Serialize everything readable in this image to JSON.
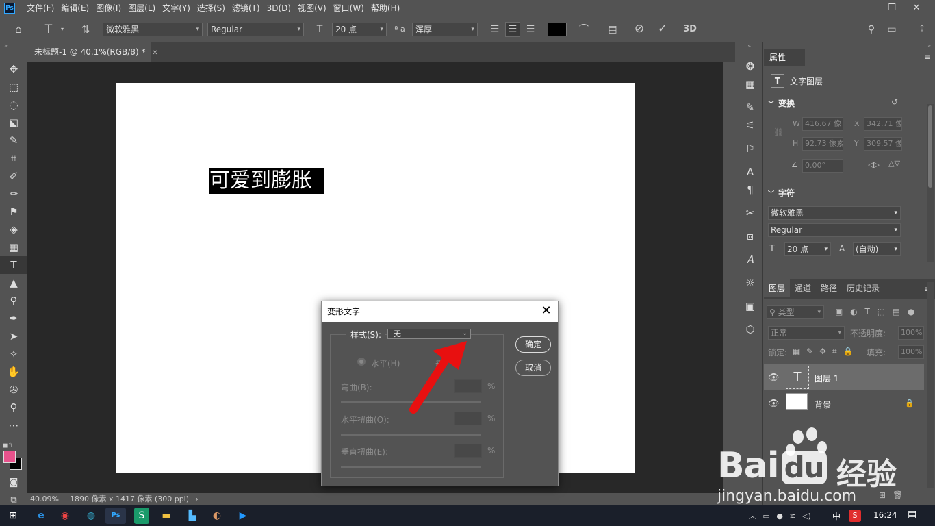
{
  "menubar": {
    "logo": "Ps",
    "items": [
      "文件(F)",
      "编辑(E)",
      "图像(I)",
      "图层(L)",
      "文字(Y)",
      "选择(S)",
      "滤镜(T)",
      "3D(D)",
      "视图(V)",
      "窗口(W)",
      "帮助(H)"
    ]
  },
  "options": {
    "font_family": "微软雅黑",
    "font_style": "Regular",
    "font_size": "20 点",
    "aa_label": "ª a",
    "antialias": "浑厚",
    "threed": "3D"
  },
  "document": {
    "tab_title": "未标题-1 @ 40.1%(RGB/8) *",
    "text": "可爱到膨胀",
    "zoom": "40.09%",
    "dims": "1890 像素 x 1417 像素 (300 ppi)"
  },
  "properties": {
    "tab": "属性",
    "layer_kind": "文字图层",
    "transform_title": "变换",
    "w_label": "W",
    "w_value": "416.67 像",
    "x_label": "X",
    "x_value": "342.71 像",
    "h_label": "H",
    "h_value": "92.73 像素",
    "y_label": "Y",
    "y_value": "309.57 像",
    "angle_value": "0.00°",
    "char_title": "字符",
    "font_family": "微软雅黑",
    "font_style": "Regular",
    "font_size": "20 点",
    "leading": "(自动)"
  },
  "layers_panel": {
    "tabs": [
      "图层",
      "通道",
      "路径",
      "历史记录"
    ],
    "filter_label": "类型",
    "blend_mode": "正常",
    "opacity_label": "不透明度:",
    "opacity_value": "100%",
    "lock_label": "锁定:",
    "fill_label": "填充:",
    "fill_value": "100%",
    "layers": [
      {
        "name": "图层 1",
        "type": "text",
        "selected": true
      },
      {
        "name": "背景",
        "type": "background",
        "selected": false
      }
    ]
  },
  "dialog": {
    "title": "变形文字",
    "style_label": "样式(S):",
    "style_value": "无",
    "horizontal_label": "水平(H)",
    "vertical_label": "垂",
    "bend_label": "弯曲(B):",
    "hdistort_label": "水平扭曲(O):",
    "vdistort_label": "垂直扭曲(E):",
    "percent": "%",
    "ok_label": "确定",
    "cancel_label": "取消"
  },
  "taskbar": {
    "ime": "中",
    "time": "16:24"
  },
  "watermark": {
    "brand": "Bai",
    "brand2": "du",
    "cn": "经验",
    "url": "jingyan.baidu.com"
  },
  "colors": {
    "foreground": "#e8528c",
    "background": "#000000",
    "arrow": "#e81010"
  }
}
